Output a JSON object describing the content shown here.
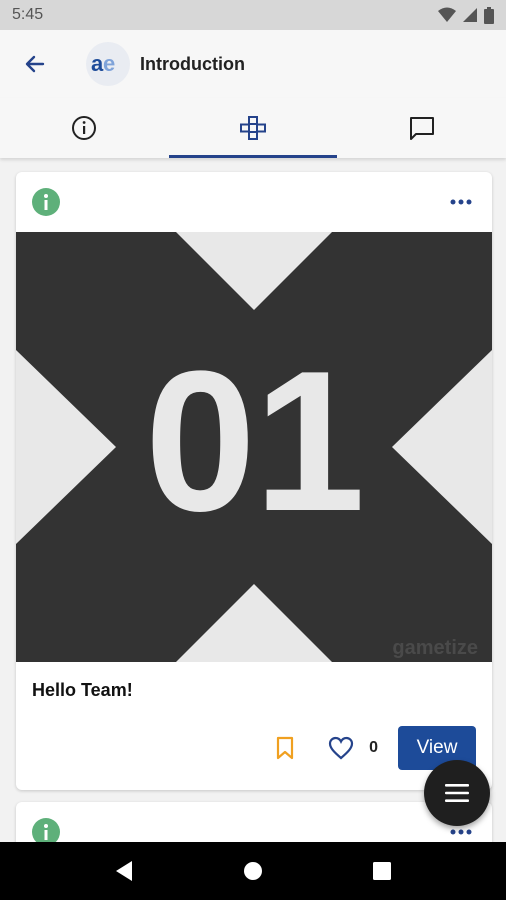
{
  "status_bar": {
    "time": "5:45",
    "icons": [
      "wifi-icon",
      "signal-icon",
      "battery-icon"
    ]
  },
  "app_bar": {
    "title": "Introduction",
    "logo_text": "ae",
    "back_icon": "arrow-left-icon"
  },
  "tabs": [
    {
      "icon": "info-icon",
      "active": false
    },
    {
      "icon": "gamepad-icon",
      "active": true
    },
    {
      "icon": "chat-icon",
      "active": false
    }
  ],
  "cards": [
    {
      "badge_icon": "info-icon",
      "image_number": "01",
      "watermark": "gametize",
      "title": "Hello Team!",
      "like_count": "0",
      "view_label": "View"
    }
  ],
  "colors": {
    "accent": "#1d4b99",
    "badge_green": "#5eb07a",
    "bookmark_orange": "#f0a020",
    "image_dark": "#333333"
  },
  "fab": {
    "icon": "menu-icon"
  },
  "nav_bar": {
    "icons": [
      "back-triangle-icon",
      "home-circle-icon",
      "recents-square-icon"
    ]
  }
}
